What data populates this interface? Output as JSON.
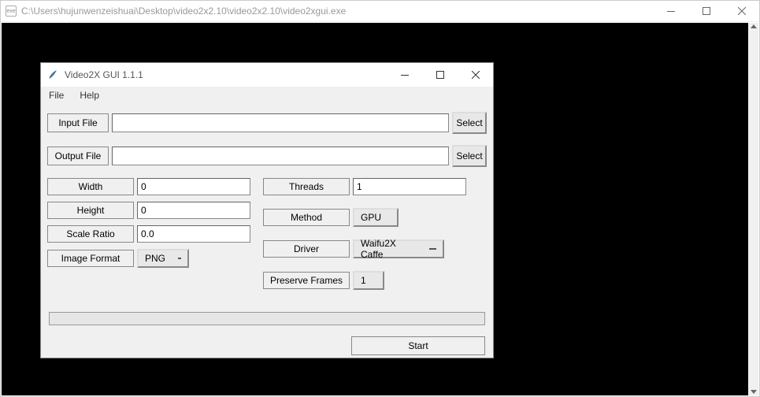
{
  "outer": {
    "title": "C:\\Users\\hujunwenzeishuai\\Desktop\\video2x2.10\\video2x2.10\\video2xgui.exe",
    "icon_text": "exe"
  },
  "inner": {
    "title": "Video2X GUI 1.1.1"
  },
  "menu": {
    "file": "File",
    "help": "Help"
  },
  "file_section": {
    "input_label": "Input File",
    "input_value": "",
    "output_label": "Output File",
    "output_value": "",
    "select": "Select"
  },
  "options": {
    "width_label": "Width",
    "width_value": "0",
    "height_label": "Height",
    "height_value": "0",
    "scale_label": "Scale Ratio",
    "scale_value": "0.0",
    "image_format_label": "Image Format",
    "image_format_value": "PNG",
    "threads_label": "Threads",
    "threads_value": "1",
    "method_label": "Method",
    "method_value": "GPU",
    "driver_label": "Driver",
    "driver_value": "Waifu2X Caffe",
    "preserve_label": "Preserve Frames",
    "preserve_value": "1"
  },
  "start": "Start"
}
